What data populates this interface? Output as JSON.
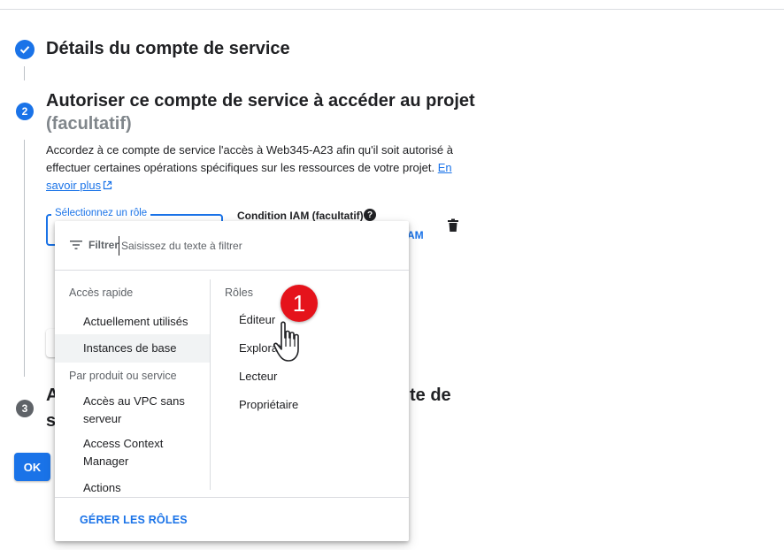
{
  "steps": {
    "step1": {
      "title": "Détails du compte de service"
    },
    "step2": {
      "number": "2",
      "title": "Autoriser ce compte de service à accéder au projet",
      "optional": "(facultatif)",
      "description": "Accordez à ce compte de service l'accès à Web345-A23 afin qu'il soit autorisé à effectuer certaines opérations spécifiques sur les ressources de votre projet.",
      "learn_more": "En savoir plus"
    },
    "step3": {
      "number": "3",
      "title_start": "A",
      "title_line2_start": "s",
      "title_tail": "te de"
    }
  },
  "role_field": {
    "label": "Sélectionnez un rôle",
    "condition_label": "Condition IAM (facultatif)",
    "condition_action_fragment": "AM"
  },
  "ok_button": "OK",
  "dropdown": {
    "filter_label": "Filtrer",
    "filter_placeholder": "Saisissez du texte à filtrer",
    "quick_access_header": "Accès rapide",
    "quick_access_items": [
      "Actuellement utilisés",
      "Instances de base"
    ],
    "selected_left_item": "Instances de base",
    "by_product_header": "Par produit ou service",
    "product_items": [
      "Accès au VPC sans serveur",
      "Access Context Manager",
      "Actions"
    ],
    "roles_header": "Rôles",
    "roles": [
      "Éditeur",
      "Explorateur",
      "Lecteur",
      "Propriétaire"
    ],
    "manage_roles": "GÉRER LES RÔLES"
  },
  "annotation": {
    "badge_number": "1"
  },
  "icons": {
    "step1_status": "check-circle-icon",
    "help": "help-icon",
    "delete": "trash-icon",
    "filter": "filter-icon",
    "external_link": "external-link-icon",
    "cursor": "hand-pointer-icon"
  },
  "colors": {
    "primary": "#1a73e8",
    "text": "#202124",
    "muted": "#5f6368",
    "badge": "#e5131b"
  }
}
